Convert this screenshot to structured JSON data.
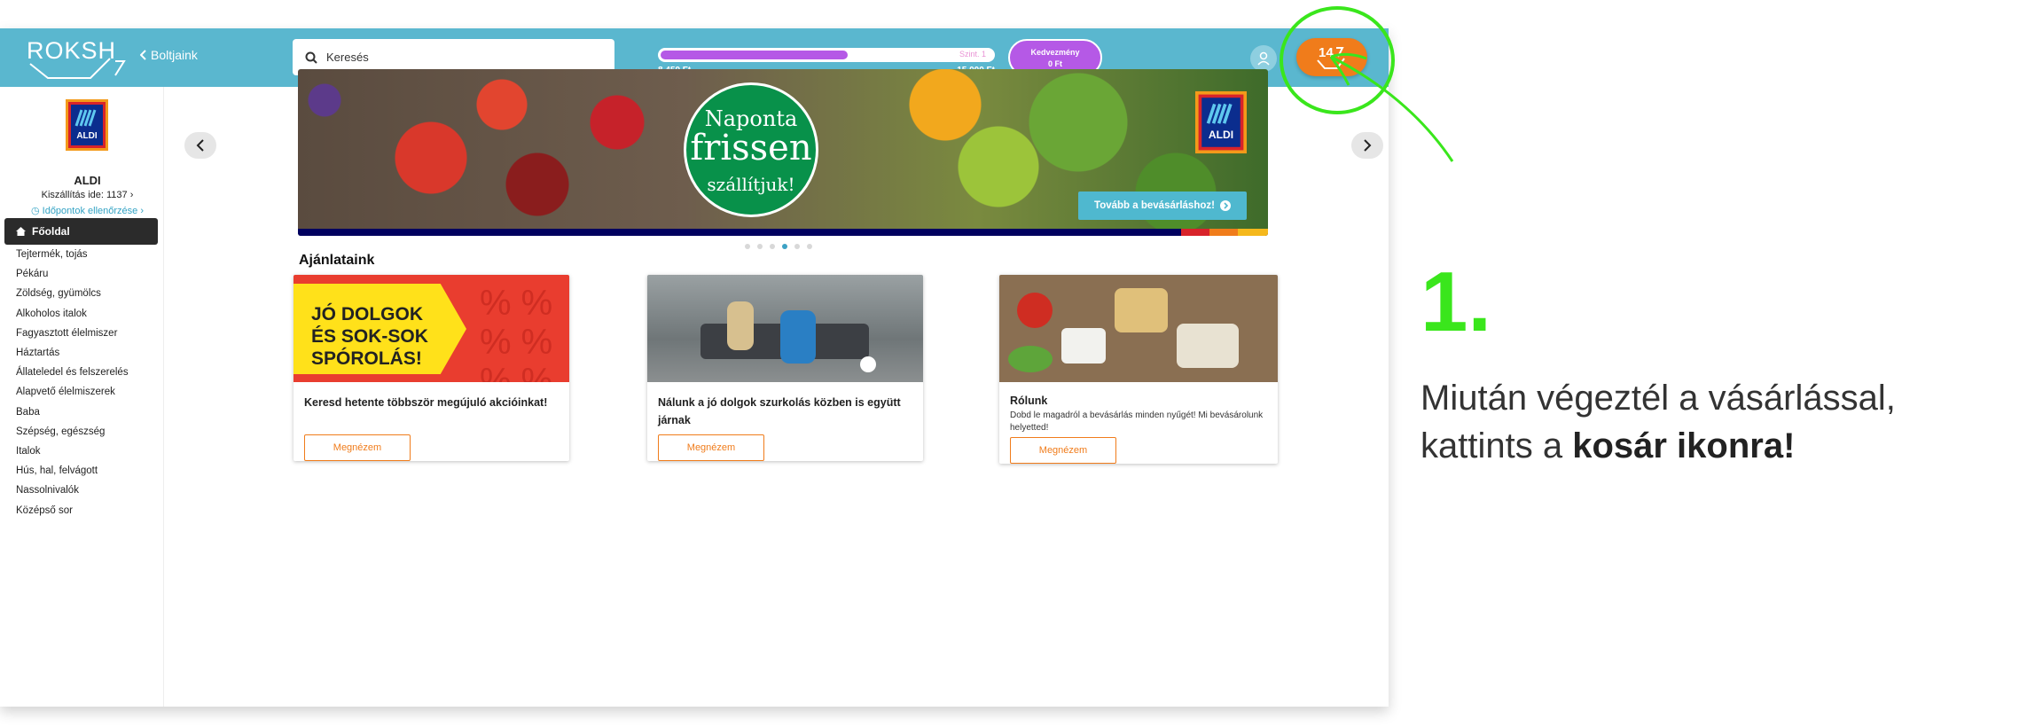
{
  "header": {
    "logo_text": "ROKSH",
    "back_link": "Boltjaink",
    "search_placeholder": "Keresés",
    "progress": {
      "current_label": "8 459 Ft",
      "target_label": "15 000 Ft",
      "level_label": "Szint. 1",
      "fraction": 0.564
    },
    "discount": {
      "title": "Kedvezmény",
      "value": "0 Ft"
    },
    "cart_count": "14"
  },
  "sidebar": {
    "store_name": "ALDI",
    "delivery_text": "Kiszállítás ide: 1137 ›",
    "timeslot_link": "Időpontok ellenőrzése ›",
    "home_label": "Főoldal",
    "categories": [
      "Tejtermék, tojás",
      "Pékáru",
      "Zöldség, gyümölcs",
      "Alkoholos italok",
      "Fagyasztott élelmiszer",
      "Háztartás",
      "Állateledel és felszerelés",
      "Alapvető élelmiszerek",
      "Baba",
      "Szépség, egészség",
      "Italok",
      "Hús, hal, felvágott",
      "Nassolnivalók",
      "Középső sor"
    ]
  },
  "banner": {
    "line1": "Naponta",
    "line2": "frissen",
    "line3": "szállítjuk!",
    "brand": "ALDI",
    "cta": "Tovább a bevásárláshoz!",
    "slides_count": 6,
    "active_slide": 3
  },
  "offers": {
    "title": "Ajánlataink",
    "cards": [
      {
        "image_text": [
          "JÓ DOLGOK",
          "ÉS SOK-SOK",
          "SPÓROLÁS!"
        ],
        "title": "Keresd hetente többször megújuló akcióinkat!",
        "desc": "",
        "button": "Megnézem"
      },
      {
        "title": "Nálunk a jó dolgok szurkolás közben is együtt járnak",
        "desc": "",
        "button": "Megnézem"
      },
      {
        "title": "Rólunk",
        "desc": "Dobd le magadról a bevásárlás minden nyűgét! Mi bevásárolunk helyetted!",
        "button": "Megnézem"
      }
    ]
  },
  "annotation": {
    "step": "1.",
    "text_before": "Miután végeztél a vásárlással, kattints a",
    "text_bold": "kosár ikonra!"
  },
  "colors": {
    "topbar": "#5ab7cf",
    "accent_orange": "#f07c1b",
    "accent_purple": "#b559e6",
    "annotation_green": "#3ae61c"
  },
  "icons": [
    "basket-logo-icon",
    "chevron-left-icon",
    "search-icon",
    "user-icon",
    "basket-icon",
    "home-icon",
    "clock-icon",
    "arrow-right-circle-icon",
    "chevron-left-icon",
    "chevron-right-icon",
    "aldi-logo",
    "pointer-arrow-icon",
    "highlight-circle"
  ]
}
